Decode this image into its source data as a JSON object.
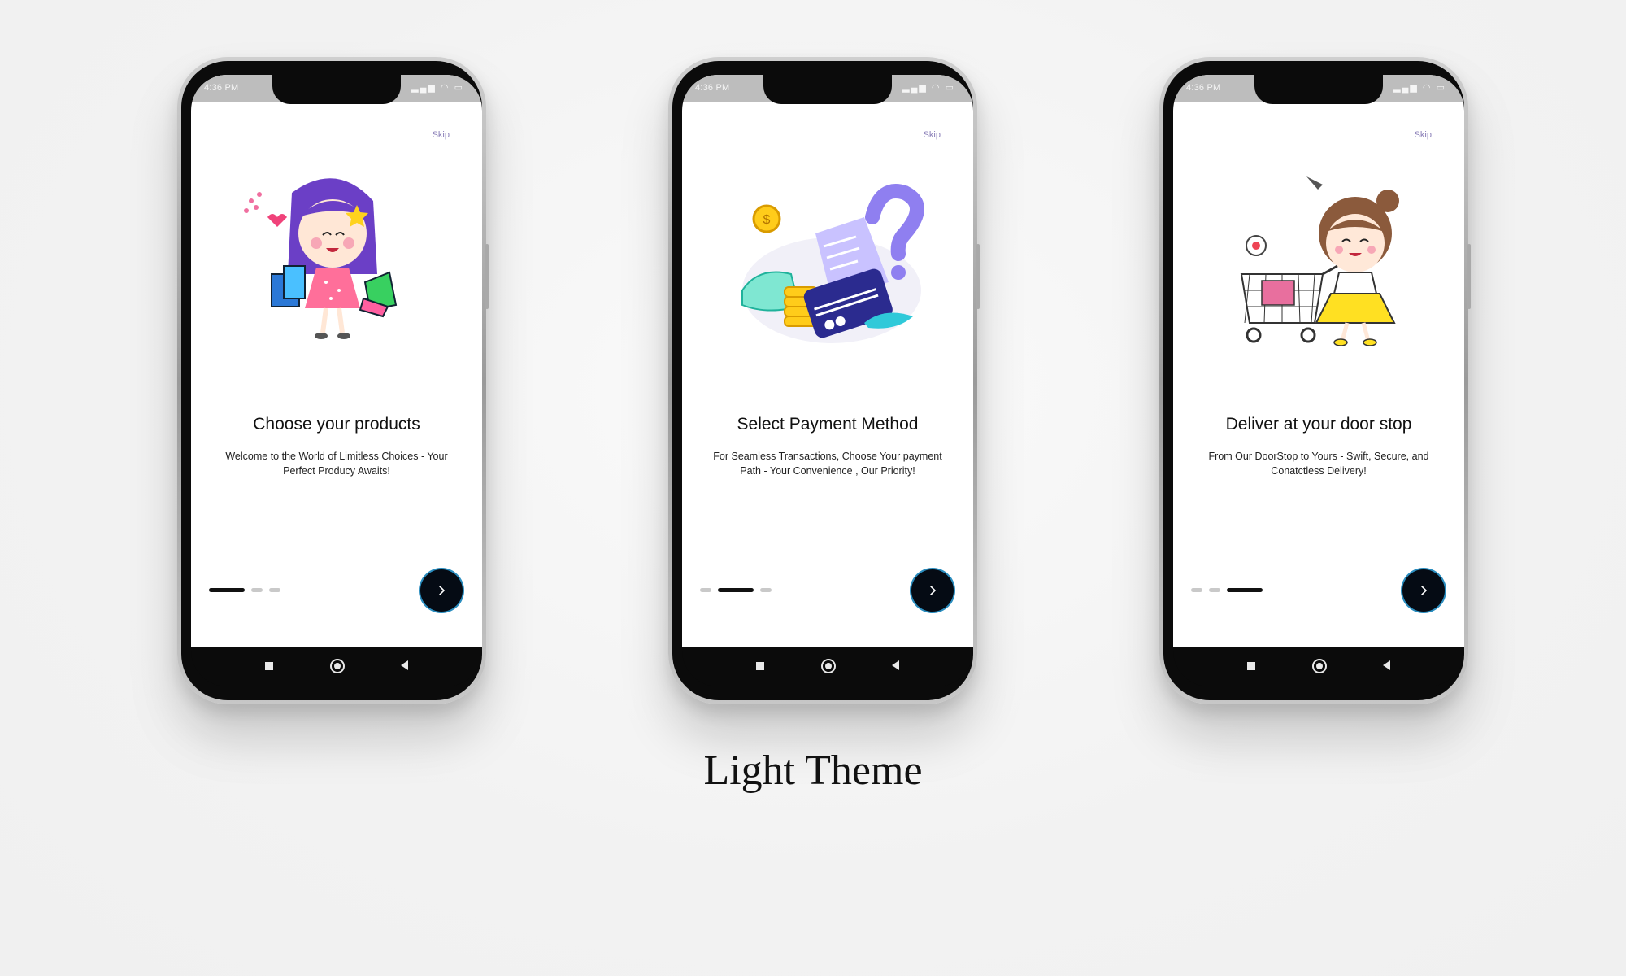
{
  "status_bar": {
    "time": "4:36 PM",
    "icons": [
      "signal-icon",
      "wifi-icon",
      "battery-icon"
    ]
  },
  "common": {
    "skip_label": "Skip",
    "next_icon": "chevron-right-icon"
  },
  "screens": [
    {
      "title": "Choose your products",
      "subtitle": "Welcome to the World of Limitless Choices - Your Perfect Producy Awaits!",
      "active_dot": 0,
      "illustration": "girl-with-shopping-bags"
    },
    {
      "title": "Select Payment Method",
      "subtitle": "For Seamless Transactions, Choose Your payment Path - Your Convenience , Our Priority!",
      "active_dot": 1,
      "illustration": "payment-card-and-coins"
    },
    {
      "title": "Deliver at your door stop",
      "subtitle": "From Our  DoorStop to Yours - Swift, Secure, and Conatctless Delivery!",
      "active_dot": 2,
      "illustration": "girl-with-shopping-cart"
    }
  ],
  "caption": "Light Theme",
  "colors": {
    "skip": "#8a7fb8",
    "next_button": "#050b14",
    "next_ring": "#2a8dbf",
    "dot_active": "#111111",
    "dot_inactive": "#c9c9c9"
  }
}
